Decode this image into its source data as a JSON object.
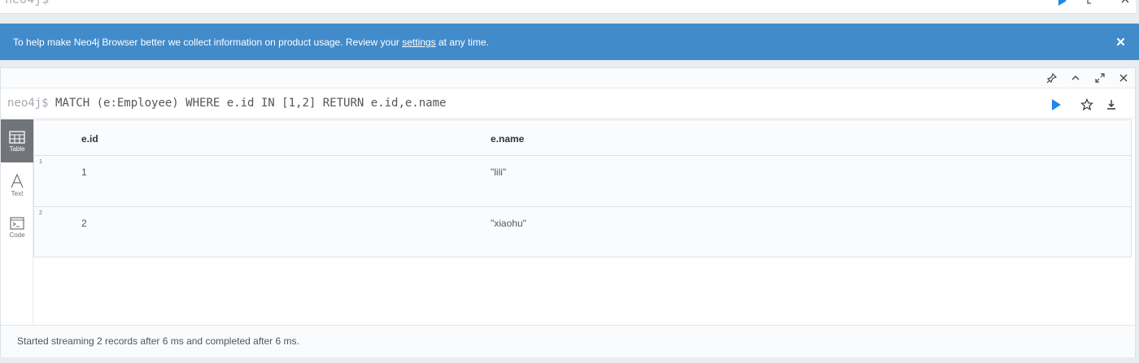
{
  "top_editor": {
    "prompt": "neo4j$",
    "icons": [
      "play-icon",
      "expand-icon",
      "close-icon"
    ]
  },
  "banner": {
    "text_before": "To help make Neo4j Browser better we collect information on product usage. Review your ",
    "link": "settings",
    "text_after": " at any time.",
    "close_icon": "close-icon",
    "color": "#428bca"
  },
  "frame": {
    "header_icons": [
      "pin-icon",
      "chevron-up-icon",
      "expand-icon",
      "close-icon"
    ],
    "query": {
      "prompt": "neo4j$",
      "text": "MATCH (e:Employee) WHERE e.id IN [1,2] RETURN e.id,e.name"
    },
    "query_actions": [
      "play-icon",
      "star-icon",
      "download-icon"
    ],
    "views": [
      {
        "label": "Table",
        "icon": "table-icon",
        "active": true
      },
      {
        "label": "Text",
        "icon": "text-icon",
        "active": false
      },
      {
        "label": "Code",
        "icon": "code-icon",
        "active": false
      }
    ],
    "table": {
      "columns": [
        "e.id",
        "e.name"
      ],
      "rows": [
        {
          "num": "1",
          "cells": [
            "1",
            "\"lili\""
          ]
        },
        {
          "num": "2",
          "cells": [
            "2",
            "\"xiaohu\""
          ]
        }
      ]
    },
    "status": "Started streaming 2 records after 6 ms and completed after 6 ms."
  },
  "colors": {
    "accent": "#428bca",
    "play": "#1e88e5",
    "active_view": "#71757a"
  }
}
